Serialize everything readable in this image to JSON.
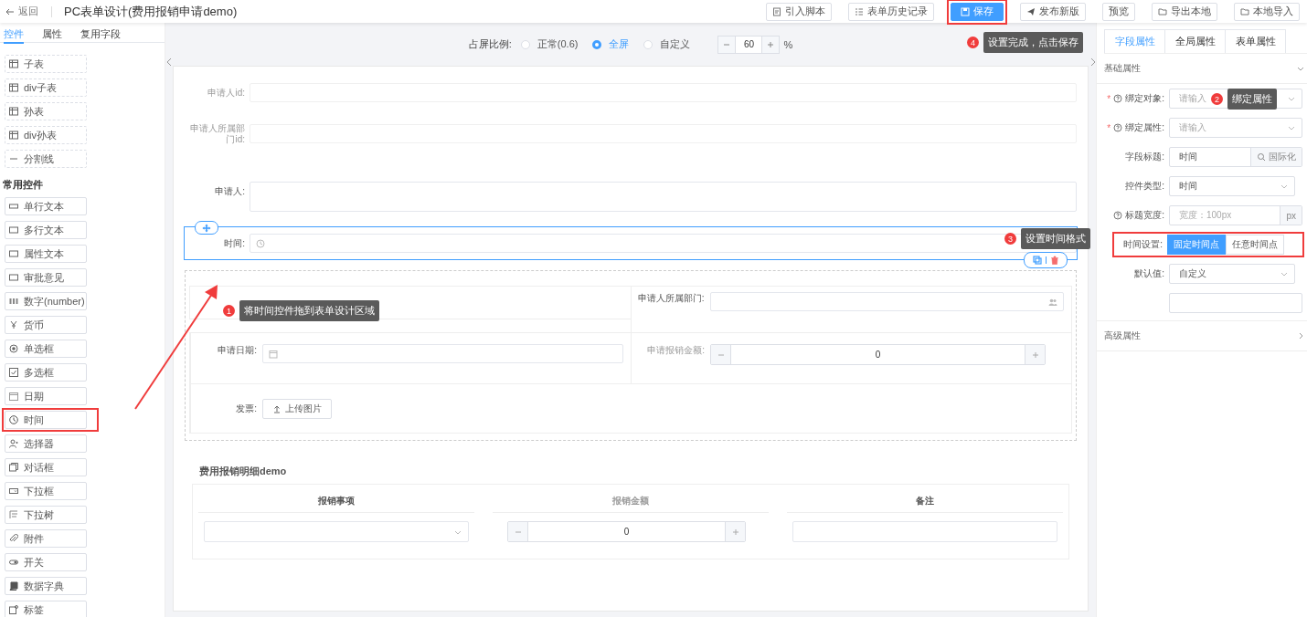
{
  "header": {
    "back_label": "返回",
    "title": "PC表单设计(费用报销申请demo)"
  },
  "toolbar": [
    {
      "label": "引入脚本",
      "kind": "script",
      "primary": false,
      "highlighted": false
    },
    {
      "label": "表单历史记录",
      "kind": "history",
      "primary": false,
      "highlighted": false
    },
    {
      "label": "保存",
      "kind": "save",
      "primary": true,
      "highlighted": true
    },
    {
      "label": "发布新版",
      "kind": "send",
      "primary": false,
      "highlighted": false
    },
    {
      "label": "预览",
      "kind": "none",
      "primary": false,
      "highlighted": false
    },
    {
      "label": "导出本地",
      "kind": "folder",
      "primary": false,
      "highlighted": false
    },
    {
      "label": "本地导入",
      "kind": "folder",
      "primary": false,
      "highlighted": false
    }
  ],
  "left_tabs": [
    {
      "label": "控件",
      "selected": true
    },
    {
      "label": "属性",
      "selected": false
    },
    {
      "label": "复用字段",
      "selected": false
    }
  ],
  "palette": [
    {
      "kind": "layout",
      "items": [
        {
          "label": "子表",
          "kind": "table",
          "highlighted": false
        },
        {
          "label": "div子表",
          "kind": "table",
          "highlighted": false
        },
        {
          "label": "孙表",
          "kind": "table",
          "highlighted": false
        },
        {
          "label": "div孙表",
          "kind": "table",
          "highlighted": false
        },
        {
          "label": "分割线",
          "kind": "divider",
          "highlighted": false
        }
      ]
    },
    {
      "kind": "basic",
      "title": "常用控件",
      "items": [
        {
          "label": "单行文本",
          "kind": "input",
          "highlighted": false
        },
        {
          "label": "多行文本",
          "kind": "textarea",
          "highlighted": false
        },
        {
          "label": "属性文本",
          "kind": "textarea",
          "highlighted": false
        },
        {
          "label": "审批意见",
          "kind": "textarea",
          "highlighted": false
        },
        {
          "label": "数字(number)",
          "kind": "number",
          "highlighted": false
        },
        {
          "label": "货币",
          "kind": "currency",
          "highlighted": false
        },
        {
          "label": "单选框",
          "kind": "radio",
          "highlighted": false
        },
        {
          "label": "多选框",
          "kind": "checkbox",
          "highlighted": false
        },
        {
          "label": "日期",
          "kind": "date",
          "highlighted": false
        },
        {
          "label": "时间",
          "kind": "time",
          "highlighted": true
        },
        {
          "label": "选择器",
          "kind": "user",
          "highlighted": false
        },
        {
          "label": "对话框",
          "kind": "dialog",
          "highlighted": false
        },
        {
          "label": "下拉框",
          "kind": "select",
          "highlighted": false
        },
        {
          "label": "下拉树",
          "kind": "tree",
          "highlighted": false
        },
        {
          "label": "附件",
          "kind": "attachment",
          "highlighted": false
        },
        {
          "label": "开关",
          "kind": "switch",
          "highlighted": false
        },
        {
          "label": "数据字典",
          "kind": "book",
          "highlighted": false
        },
        {
          "label": "标签",
          "kind": "tag",
          "highlighted": false
        }
      ]
    }
  ],
  "ratio_bar": {
    "label": "占屏比例:",
    "options": [
      {
        "label": "正常(0.6)",
        "selected": false
      },
      {
        "label": "全屏",
        "selected": true
      },
      {
        "label": "自定义",
        "selected": false
      }
    ],
    "value": "60",
    "unit": "%"
  },
  "fields": [
    {
      "label": "申请人id:",
      "kind": "input",
      "hidden": true,
      "selected": false
    },
    {
      "label": "申请人所属部门id:",
      "kind": "input",
      "hidden": true,
      "selected": false
    },
    {
      "label": "申请人:",
      "kind": "textarea",
      "hidden": false,
      "selected": false
    },
    {
      "label": "时间:",
      "kind": "time",
      "hidden": false,
      "selected": true
    }
  ],
  "grid_rows": [
    [
      {
        "kind": "empty"
      },
      {
        "label": "申请人所属部门:",
        "kind": "picker",
        "hidden": false
      }
    ],
    [
      {
        "label": "申请日期:",
        "kind": "date",
        "hidden": false
      },
      {
        "label": "申请报销金额:",
        "kind": "number",
        "value": "0",
        "hidden": true
      }
    ],
    [
      {
        "label": "发票:",
        "kind": "upload",
        "button": "上传图片",
        "hidden": false
      }
    ]
  ],
  "subtable": {
    "title": "费用报销明细demo",
    "columns": [
      {
        "header": "报销事项",
        "kind": "select",
        "hidden": false
      },
      {
        "header": "报销金额",
        "kind": "number",
        "value": "0",
        "hidden": true
      },
      {
        "header": "备注",
        "kind": "textarea",
        "hidden": false
      }
    ]
  },
  "right_tabs": [
    {
      "label": "字段属性",
      "selected": true
    },
    {
      "label": "全局属性",
      "selected": false
    },
    {
      "label": "表单属性",
      "selected": false
    }
  ],
  "sections": [
    {
      "title": "基础属性",
      "expanded": true
    },
    {
      "title": "高级属性",
      "expanded": false
    }
  ],
  "props": [
    {
      "label": "绑定对象:",
      "required": true,
      "required_mark": "*",
      "help": true,
      "kind": "select",
      "placeholder": "请输入",
      "highlighted": false
    },
    {
      "label": "绑定属性:",
      "required": true,
      "required_mark": "*",
      "help": true,
      "kind": "select",
      "placeholder": "请输入",
      "highlighted": false
    },
    {
      "label": "字段标题:",
      "required": false,
      "help": false,
      "kind": "search-addon",
      "value": "时间",
      "addon": "国际化",
      "highlighted": false
    },
    {
      "label": "控件类型:",
      "required": false,
      "help": false,
      "kind": "select",
      "value": "时间",
      "highlighted": false
    },
    {
      "label": "标题宽度:",
      "required": false,
      "help": true,
      "kind": "addon",
      "placeholder": "宽度：100px",
      "addon": "px",
      "highlighted": false
    },
    {
      "label": "时间设置:",
      "required": false,
      "help": false,
      "kind": "segmented",
      "options": [
        {
          "label": "固定时间点",
          "selected": true
        },
        {
          "label": "任意时间点",
          "selected": false
        }
      ],
      "highlighted": true
    },
    {
      "label": "默认值:",
      "required": false,
      "help": false,
      "kind": "select",
      "value": "自定义",
      "highlighted": false
    },
    {
      "required": false,
      "help": false,
      "kind": "input",
      "highlighted": false
    }
  ],
  "callouts": [
    {
      "number": "4",
      "text": "设置完成，点击保存"
    },
    {
      "number": "2",
      "text": "绑定属性"
    },
    {
      "number": "3",
      "text": "设置时间格式"
    },
    {
      "number": "1",
      "text": "将时间控件拖到表单设计区域"
    }
  ]
}
